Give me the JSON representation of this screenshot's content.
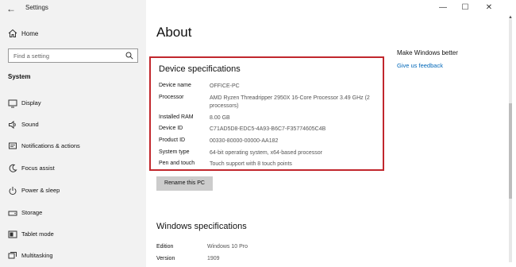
{
  "window": {
    "title": "Settings",
    "back_glyph": "←",
    "min_glyph": "—",
    "max_glyph": "☐",
    "close_glyph": "✕"
  },
  "sidebar": {
    "home_label": "Home",
    "search_placeholder": "Find a setting",
    "section_label": "System",
    "items": [
      {
        "label": "Display",
        "icon": "display-icon"
      },
      {
        "label": "Sound",
        "icon": "sound-icon"
      },
      {
        "label": "Notifications & actions",
        "icon": "notifications-icon"
      },
      {
        "label": "Focus assist",
        "icon": "focus-assist-icon"
      },
      {
        "label": "Power & sleep",
        "icon": "power-icon"
      },
      {
        "label": "Storage",
        "icon": "storage-icon"
      },
      {
        "label": "Tablet mode",
        "icon": "tablet-mode-icon"
      },
      {
        "label": "Multitasking",
        "icon": "multitasking-icon"
      }
    ]
  },
  "main": {
    "title": "About",
    "device_specs": {
      "heading": "Device specifications",
      "rows": [
        {
          "key": "Device name",
          "value": "OFFICE-PC"
        },
        {
          "key": "Processor",
          "value": "AMD Ryzen Threadripper 2950X 16-Core Processor 3.49 GHz  (2 processors)"
        },
        {
          "key": "Installed RAM",
          "value": "8.00 GB"
        },
        {
          "key": "Device ID",
          "value": "C71AD5D8-EDC5-4A93-B6C7-F35774605C4B"
        },
        {
          "key": "Product ID",
          "value": "00330-80000-00000-AA182"
        },
        {
          "key": "System type",
          "value": "64-bit operating system, x64-based processor"
        },
        {
          "key": "Pen and touch",
          "value": "Touch support with 8 touch points"
        }
      ],
      "highlight_color": "#c1272d"
    },
    "rename_button": "Rename this PC",
    "windows_specs": {
      "heading": "Windows specifications",
      "rows": [
        {
          "key": "Edition",
          "value": "Windows 10 Pro"
        },
        {
          "key": "Version",
          "value": "1909"
        }
      ]
    }
  },
  "side_panel": {
    "title": "Make Windows better",
    "link": "Give us feedback",
    "link_color": "#0067b8"
  }
}
